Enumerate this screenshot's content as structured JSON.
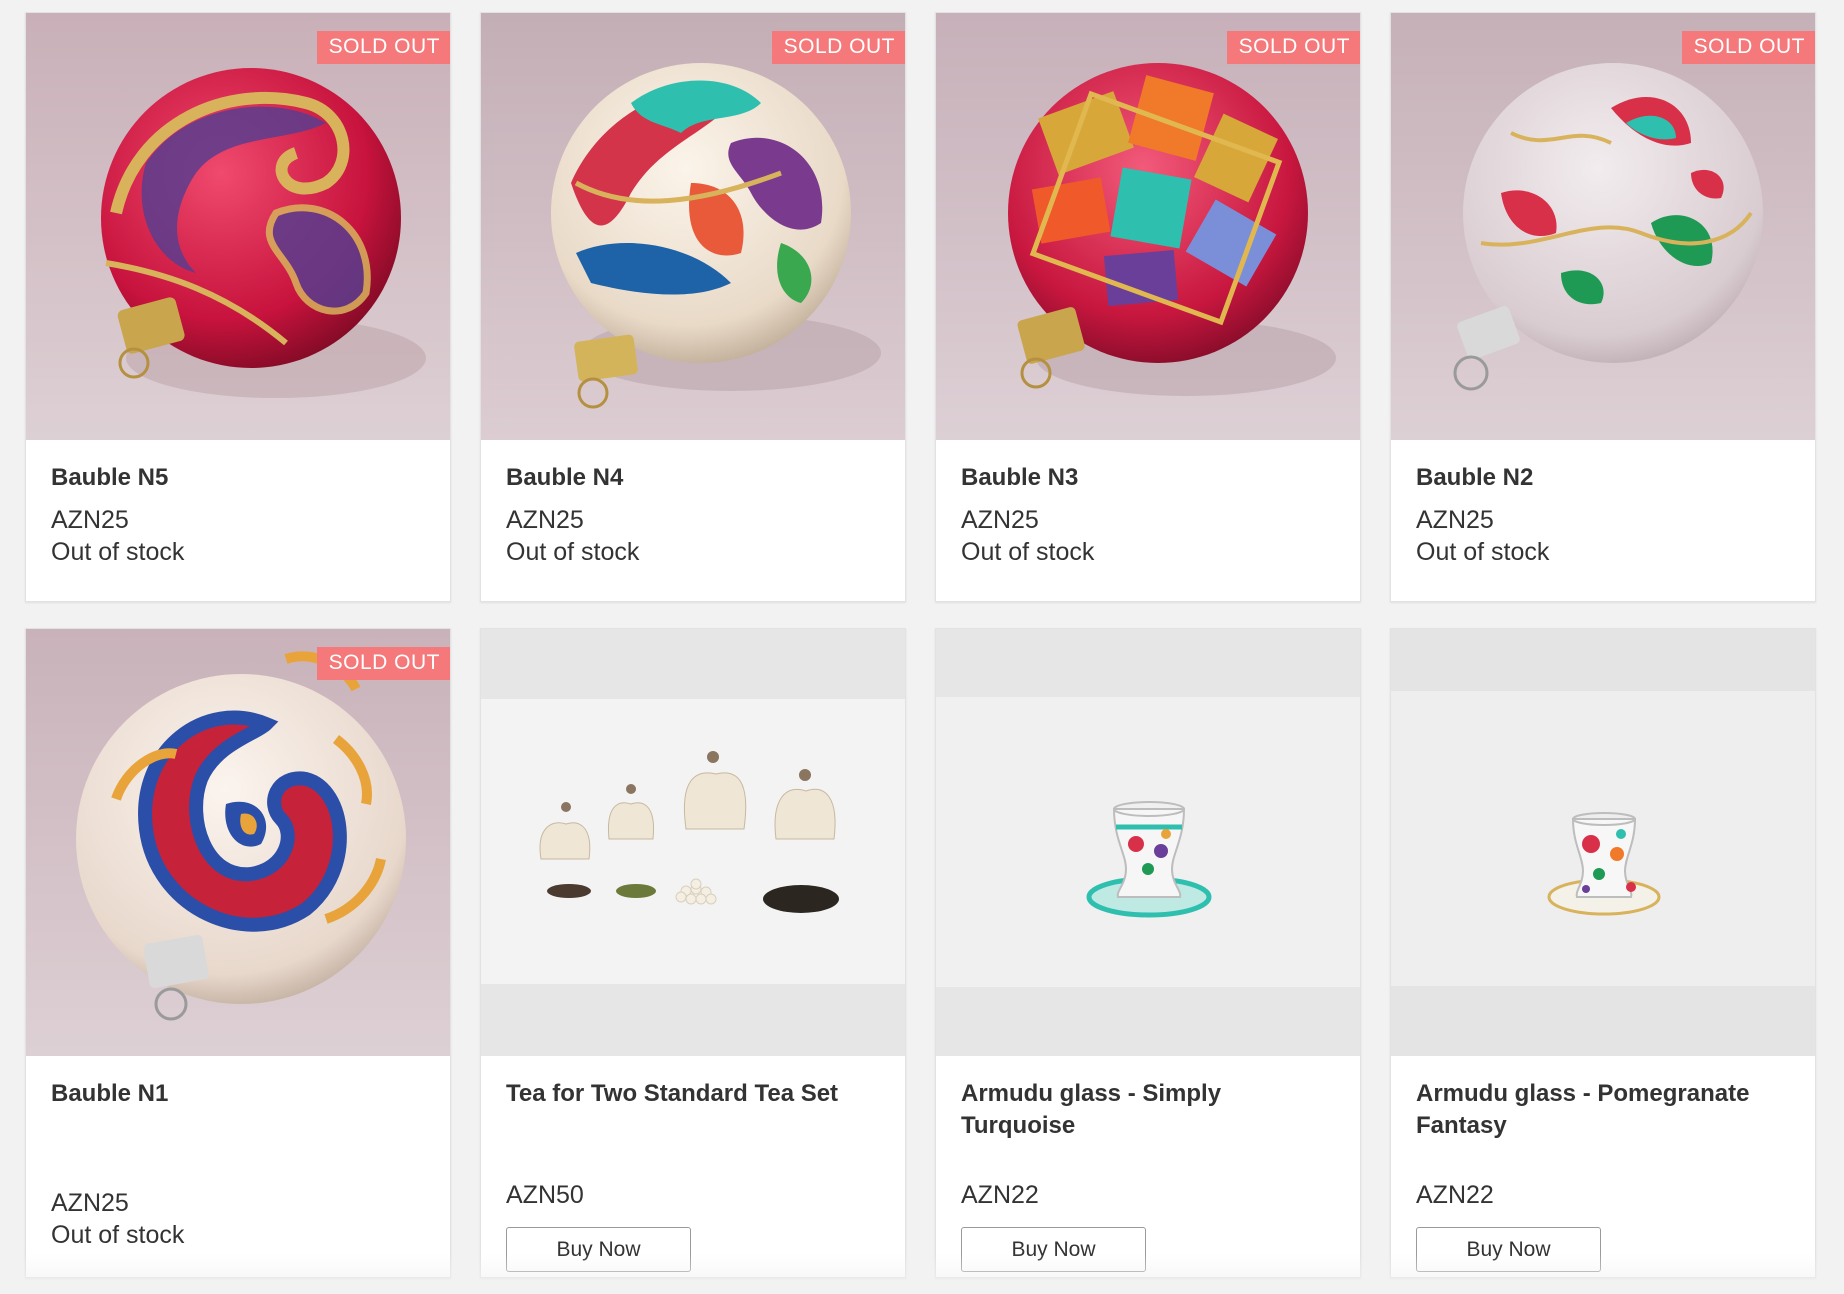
{
  "colors": {
    "badge": "#f5787a",
    "card_bg": "#ffffff",
    "text": "#333333",
    "page_bg": "#f2f2f2"
  },
  "products": [
    {
      "name": "Bauble N5",
      "price": "AZN25",
      "stock": "Out of stock",
      "badge": "SOLD OUT"
    },
    {
      "name": "Bauble N4",
      "price": "AZN25",
      "stock": "Out of stock",
      "badge": "SOLD OUT"
    },
    {
      "name": "Bauble N3",
      "price": "AZN25",
      "stock": "Out of stock",
      "badge": "SOLD OUT"
    },
    {
      "name": "Bauble N2",
      "price": "AZN25",
      "stock": "Out of stock",
      "badge": "SOLD OUT"
    },
    {
      "name": "Bauble N1",
      "price": "AZN25",
      "stock": "Out of stock",
      "badge": "SOLD OUT"
    },
    {
      "name": "Tea for Two Standard Tea Set",
      "price": "AZN50",
      "button": "Buy Now"
    },
    {
      "name": "Armudu glass - Simply Turquoise",
      "price": "AZN22",
      "button": "Buy Now"
    },
    {
      "name": "Armudu glass - Pomegranate Fantasy",
      "price": "AZN22",
      "button": "Buy Now"
    }
  ]
}
